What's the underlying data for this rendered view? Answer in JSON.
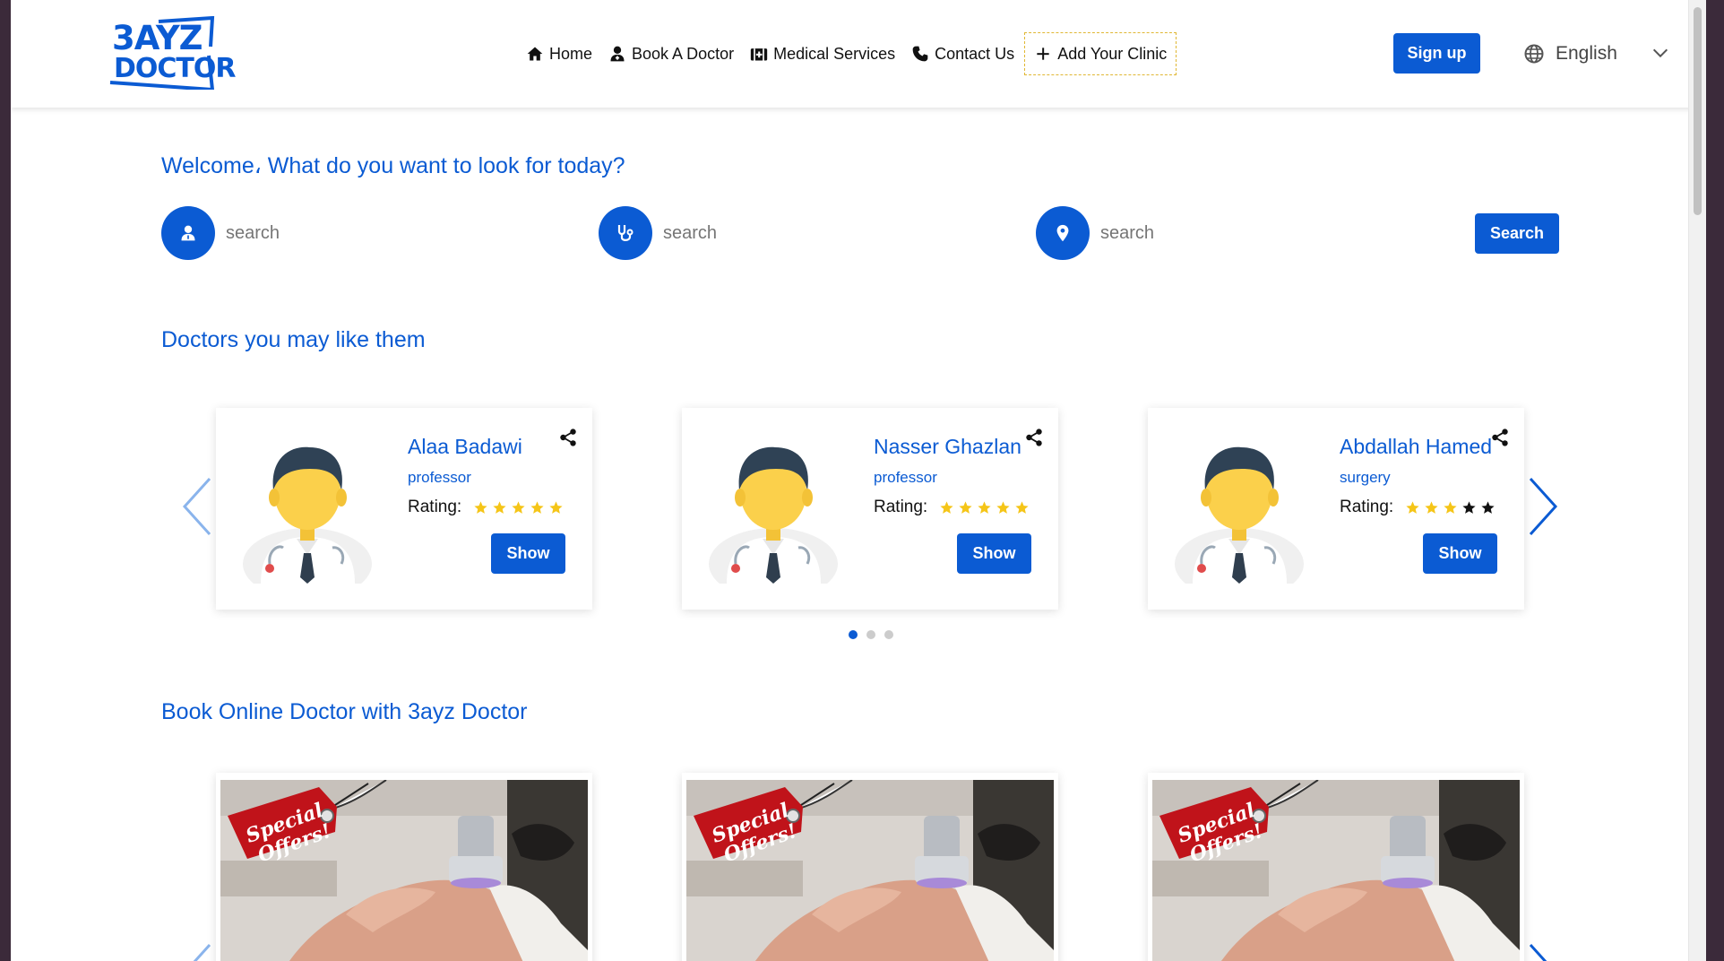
{
  "header": {
    "logo_line1": "3AYZ",
    "logo_line2": "DOCTOR",
    "nav": [
      {
        "label": "Home",
        "icon": "home-icon"
      },
      {
        "label": "Book A Doctor",
        "icon": "doctor-icon"
      },
      {
        "label": "Medical Services",
        "icon": "medical-kit-icon"
      },
      {
        "label": "Contact Us",
        "icon": "phone-icon"
      },
      {
        "label": "Add Your Clinic",
        "icon": "plus-icon"
      }
    ],
    "signup_label": "Sign up",
    "language": "English"
  },
  "search": {
    "welcome": "Welcome، What do you want to look for today?",
    "doctor_placeholder": "search",
    "specialty_placeholder": "search",
    "location_placeholder": "search",
    "button_label": "Search"
  },
  "doctors_section": {
    "title": "Doctors you may like them",
    "rating_label": "Rating:",
    "show_label": "Show",
    "cards": [
      {
        "name": "Alaa Badawi",
        "title": "professor",
        "rating": 5
      },
      {
        "name": "Nasser Ghazlan",
        "title": "professor",
        "rating": 5
      },
      {
        "name": "Abdallah Hamed",
        "title": "surgery",
        "rating": 3
      }
    ],
    "pagination": {
      "pages": 3,
      "active": 1
    }
  },
  "offers_section": {
    "title": "Book Online Doctor with 3ayz Doctor",
    "offer_tag_line1": "Special",
    "offer_tag_line2": "Offers!",
    "offers": 3
  },
  "colors": {
    "brand": "#0b5bd3",
    "star_filled": "#f5c518",
    "star_empty": "#111111"
  }
}
